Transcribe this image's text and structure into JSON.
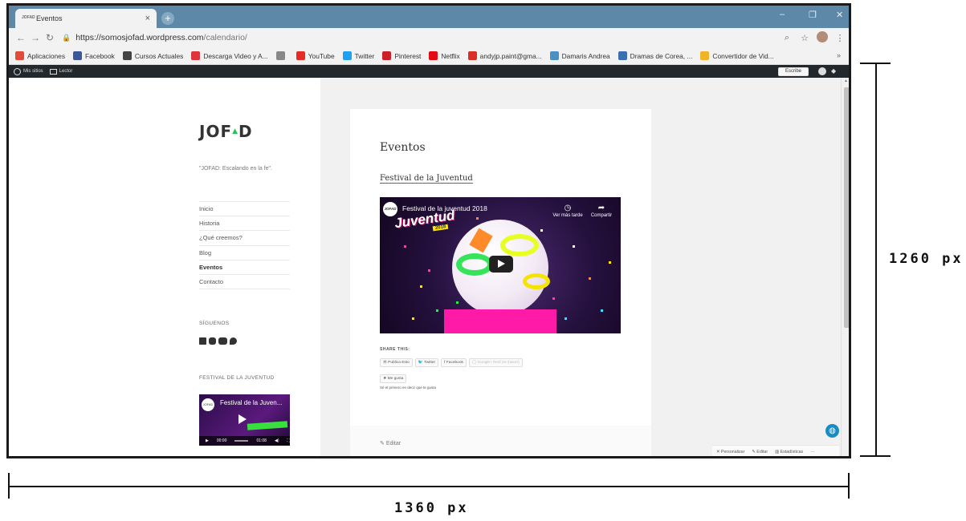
{
  "browser": {
    "tab_title": "Eventos",
    "tab_favicon_text": "JOFAD",
    "tab_close": "×",
    "new_tab": "+",
    "window_controls": [
      "–",
      "❐",
      "✕"
    ],
    "url_host": "https://somosjofad.wordpress.com",
    "url_path": "/calendario/",
    "bookmarks": [
      {
        "label": "Aplicaciones",
        "icon": "apps-grid-icon",
        "color": "#e04b3a"
      },
      {
        "label": "Facebook",
        "icon": "facebook-icon",
        "color": "#3b5998"
      },
      {
        "label": "Cursos Actuales",
        "icon": "courses-icon",
        "color": "#444444"
      },
      {
        "label": "Descarga Video y A...",
        "icon": "download-icon",
        "color": "#e0333a"
      },
      {
        "label": "",
        "icon": "page-icon",
        "color": "#888888"
      },
      {
        "label": "YouTube",
        "icon": "youtube-icon",
        "color": "#e52d27"
      },
      {
        "label": "Twitter",
        "icon": "twitter-icon",
        "color": "#1da1f2"
      },
      {
        "label": "Pinterest",
        "icon": "pinterest-icon",
        "color": "#cb2027"
      },
      {
        "label": "Netflix",
        "icon": "netflix-icon",
        "color": "#e50914"
      },
      {
        "label": "andyjp.paint@gma...",
        "icon": "gmail-icon",
        "color": "#d93025"
      },
      {
        "label": "Damaris Andrea",
        "icon": "profile-icon",
        "color": "#4a90c2"
      },
      {
        "label": "Dramas de Corea, ...",
        "icon": "bookmark-b-icon",
        "color": "#3a6fb0"
      },
      {
        "label": "Convertidor de Vid...",
        "icon": "converter-icon",
        "color": "#f0b429"
      }
    ],
    "bookmarks_more": "»"
  },
  "adminbar": {
    "my_sites": "Mis sitios",
    "reader": "Lector",
    "write": "Escribe"
  },
  "sidebar": {
    "logo": "JOF",
    "logo_tri": "▲",
    "logo_end": "D",
    "tagline": "\"JOFAD: Escalando en la fe\".",
    "nav": [
      "Inicio",
      "Historia",
      "¿Qué creemos?",
      "Blog",
      "Eventos",
      "Contacto"
    ],
    "active_nav": "Eventos",
    "follow_title": "SÍGUENOS",
    "festival_title": "FESTIVAL DE LA JUVENTUD",
    "mini_video_title": "Festival de la Juven...",
    "mini_video_logo": "JOFAD",
    "mini_time_current": "00:00",
    "mini_time_total": "01:08"
  },
  "post": {
    "title": "Eventos",
    "link": "Festival de la Juventud",
    "video": {
      "logo": "JOFAD",
      "title": "Festival de la juventud 2018",
      "big_word": "Juventud",
      "year": "2018",
      "watch_later": "Ver más tarde",
      "share": "Compartir"
    },
    "share_title": "SHARE THIS:",
    "share_buttons": [
      "Publica Esto",
      "Twitter",
      "Facebook",
      "Google+ feed (en hacer)"
    ],
    "like_button": "★ Me gusta",
    "like_text": "Sé el primero en decir que te gusta",
    "edit": "Editar"
  },
  "footer_bar": {
    "customize": "Personalizar",
    "edit": "Editar",
    "stats": "Estadísticas",
    "more": "···"
  },
  "dimensions": {
    "width_label": "1360 px",
    "height_label": "1260 px"
  }
}
